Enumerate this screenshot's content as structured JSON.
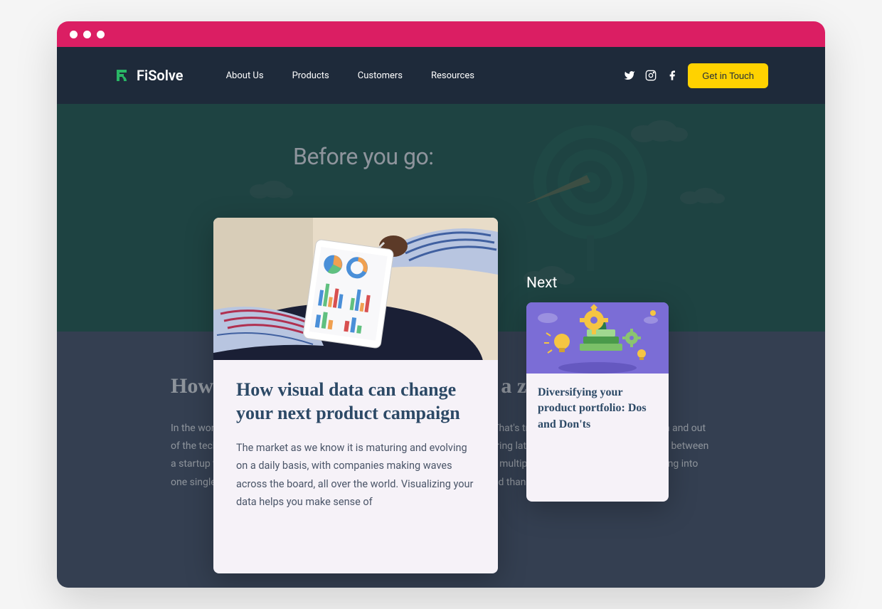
{
  "brand": {
    "name": "FiSolve",
    "accent_green": "#29b665",
    "accent_yellow": "#ffd200",
    "accent_pink": "#db1e63"
  },
  "nav": {
    "links": [
      "About Us",
      "Products",
      "Customers",
      "Resources"
    ],
    "cta": "Get in Touch",
    "social": [
      "twitter",
      "instagram",
      "facebook"
    ]
  },
  "hero": {
    "title": "Before you go:"
  },
  "background_article": {
    "title": "How to secure late-stage funding on a zoom call",
    "body": "In the world of remote-first business boardrooms, only the fittest survive. That's true for industries that are both in and out of the tech space, and is imperative to a successful business model. Securing late stage funding is the difference between a startup that's proven its value in the market and a startup and is ready to multiply and one that's stalled out. Going into one single meeting that will make the difference, and is certainly easier said than done."
  },
  "modal": {
    "next_label": "Next",
    "featured": {
      "title": "How visual data can change your next product campaign",
      "excerpt": "The market as we know it is maturing and evolving on a daily basis, with companies making waves across the board, all over the world. Visualizing your data helps you make sense of"
    },
    "next_card": {
      "title": "Diversifying your product portfolio: Dos and Don'ts"
    }
  }
}
